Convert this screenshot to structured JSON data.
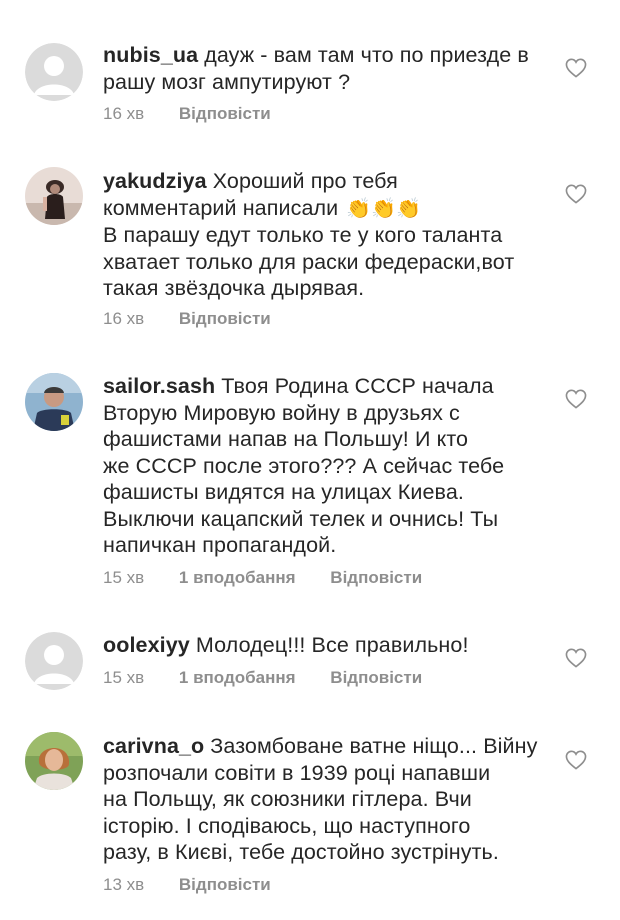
{
  "comments": [
    {
      "username": "nubis_ua",
      "lines": [
        "дауж - вам там что по приезде в",
        "рашу мозг ампутируют ?"
      ],
      "time": "16 хв",
      "likes": "",
      "reply_label": "Відповісти",
      "avatar": "default-avatar"
    },
    {
      "username": "yakudziya",
      "lines": [
        "Хороший про тебя",
        "комментарий написали",
        "В парашу едут только те у кого таланта",
        "хватает только для раски федераски,вот",
        "такая звёздочка дырявая."
      ],
      "emoji": "👏👏👏",
      "time": "16 хв",
      "likes": "",
      "reply_label": "Відповісти",
      "avatar": "photo-avatar"
    },
    {
      "username": "sailor.sash",
      "lines": [
        "Твоя Родина СССР начала",
        "Вторую Мировую войну в друзьях с",
        "фашистами напав на Польшу! И кто",
        "же СССР после этого??? А сейчас тебе",
        "фашисты видятся на улицах Киева.",
        "Выключи кацапский телек и очнись! Ты",
        "напичкан пропагандой."
      ],
      "time": "15 хв",
      "likes": "1 вподобання",
      "reply_label": "Відповісти",
      "avatar": "photo-avatar"
    },
    {
      "username": "oolexiyy",
      "lines": [
        "Молодец!!! Все правильно!"
      ],
      "time": "15 хв",
      "likes": "1 вподобання",
      "reply_label": "Відповісти",
      "avatar": "default-avatar"
    },
    {
      "username": "carivna_o",
      "lines": [
        "Зазомбоване ватне ніщо... Війну",
        "розпочали совіти в 1939 році напавши",
        "на Польщу, як союзники гітлера. Вчи",
        "історію. І сподіваюсь, що наступного",
        "разу, в Києві, тебе достойно зустрінуть."
      ],
      "time": "13 хв",
      "likes": "",
      "reply_label": "Відповісти",
      "avatar": "photo-avatar"
    }
  ],
  "icons": {
    "like": "heart-outline-icon",
    "avatar_default": "user-silhouette-icon"
  },
  "colors": {
    "text": "#262626",
    "meta": "#8e8e8e",
    "avatar_bg": "#dbdbdb"
  }
}
